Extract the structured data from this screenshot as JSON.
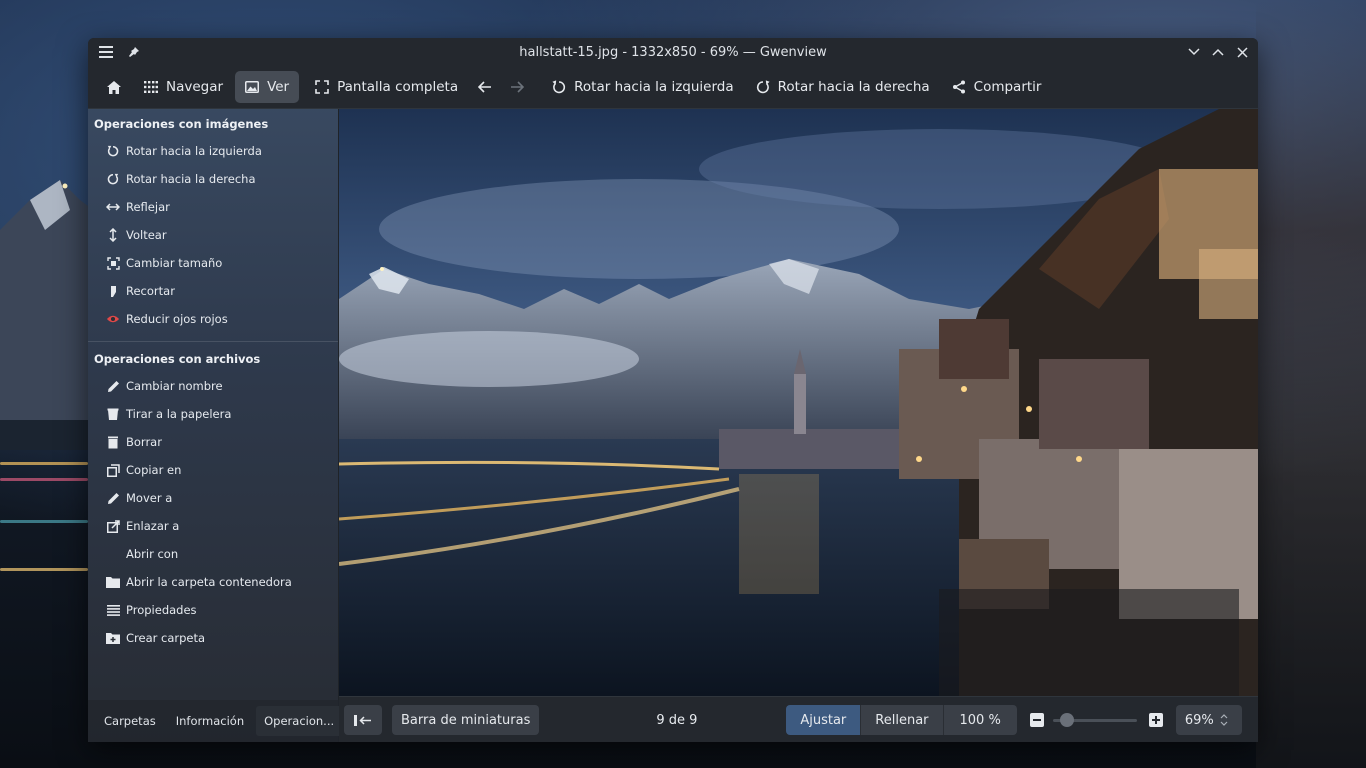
{
  "window": {
    "title": "hallstatt-15.jpg - 1332x850 - 69% — Gwenview"
  },
  "toolbar": {
    "home_label": "",
    "browse_label": "Navegar",
    "view_label": "Ver",
    "fullscreen_label": "Pantalla completa",
    "rotate_left_label": "Rotar hacia la izquierda",
    "rotate_right_label": "Rotar hacia la derecha",
    "share_label": "Compartir"
  },
  "sidebar": {
    "image_ops_title": "Operaciones con imágenes",
    "image_ops": [
      {
        "label": "Rotar hacia la izquierda",
        "icon": "rotate-left-icon"
      },
      {
        "label": "Rotar hacia la derecha",
        "icon": "rotate-right-icon"
      },
      {
        "label": "Reflejar",
        "icon": "mirror-icon"
      },
      {
        "label": "Voltear",
        "icon": "flip-icon"
      },
      {
        "label": "Cambiar tamaño",
        "icon": "resize-icon"
      },
      {
        "label": "Recortar",
        "icon": "crop-icon"
      },
      {
        "label": "Reducir ojos rojos",
        "icon": "red-eye-icon"
      }
    ],
    "file_ops_title": "Operaciones con archivos",
    "file_ops": [
      {
        "label": "Cambiar nombre",
        "icon": "pencil-icon"
      },
      {
        "label": "Tirar a la papelera",
        "icon": "trash-icon"
      },
      {
        "label": "Borrar",
        "icon": "delete-icon"
      },
      {
        "label": "Copiar en",
        "icon": "copy-icon"
      },
      {
        "label": "Mover a",
        "icon": "pencil-icon"
      },
      {
        "label": "Enlazar a",
        "icon": "link-icon"
      },
      {
        "label": "Abrir con",
        "icon": ""
      },
      {
        "label": "Abrir la carpeta contenedora",
        "icon": "folder-icon"
      },
      {
        "label": "Propiedades",
        "icon": "properties-icon"
      },
      {
        "label": "Crear carpeta",
        "icon": "new-folder-icon"
      }
    ],
    "tabs": [
      "Carpetas",
      "Información",
      "Operacion..."
    ]
  },
  "statusbar": {
    "thumbnail_bar_label": "Barra de miniaturas",
    "position_text": "9 de 9",
    "fit_label": "Ajustar",
    "fill_label": "Rellenar",
    "zoom_100_label": "100 %",
    "zoom_value": "69%",
    "zoom_level": 0.1
  },
  "colors": {
    "accent": "#3d5a80",
    "window_bg": "#24282e",
    "red_eye": "#e04848"
  }
}
